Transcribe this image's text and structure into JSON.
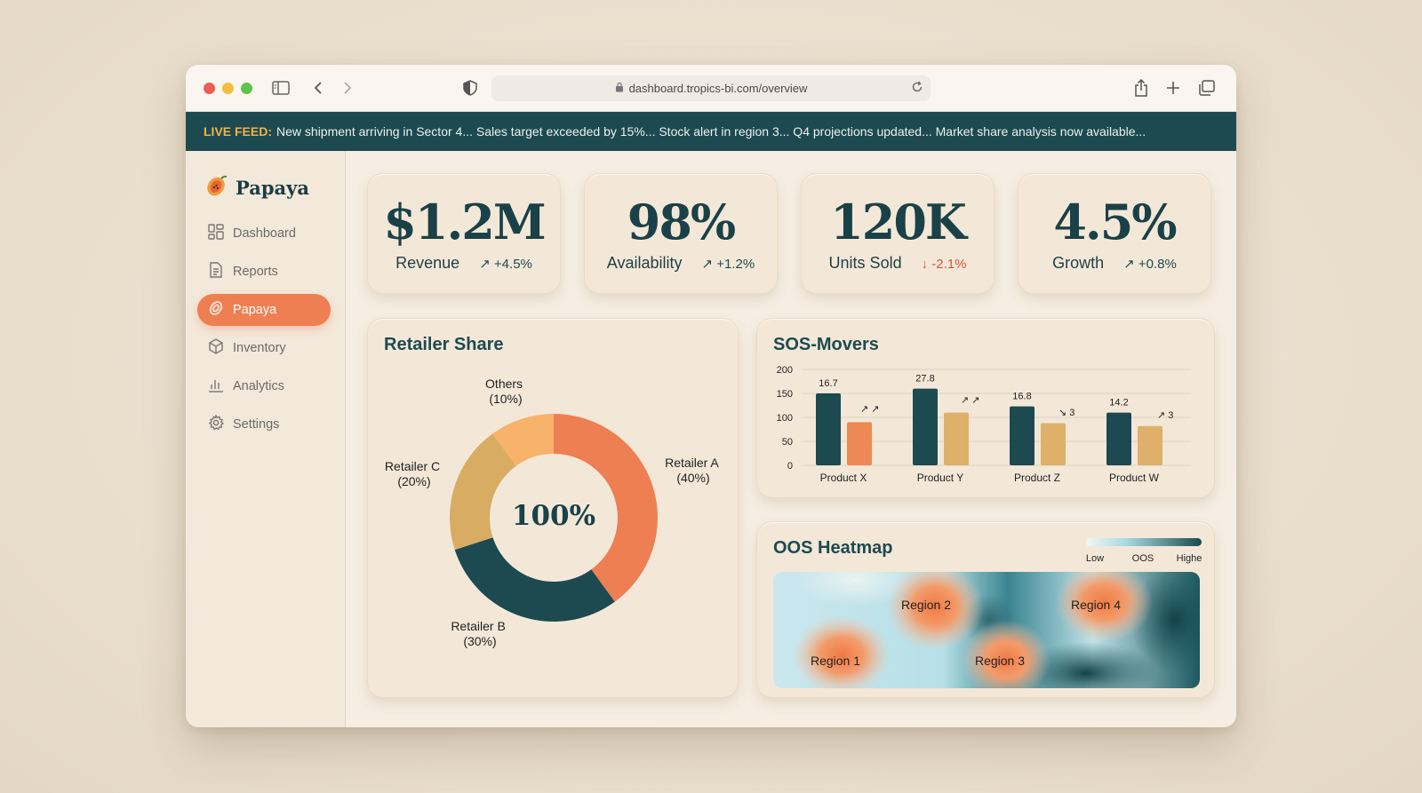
{
  "browser": {
    "url": "dashboard.tropics-bi.com/overview"
  },
  "live_feed": {
    "label": "LIVE FEED:",
    "text": "New shipment arriving in Sector 4... Sales target exceeded by 15%... Stock alert in region 3... Q4 projections updated... Market share analysis now available..."
  },
  "sidebar": {
    "brand": "Papaya",
    "items": [
      {
        "label": "Dashboard",
        "icon": "grid-icon",
        "active": false
      },
      {
        "label": "Reports",
        "icon": "document-icon",
        "active": false
      },
      {
        "label": "Papaya",
        "icon": "papaya-icon",
        "active": true
      },
      {
        "label": "Inventory",
        "icon": "box-icon",
        "active": false
      },
      {
        "label": "Analytics",
        "icon": "bar-chart-icon",
        "active": false
      },
      {
        "label": "Settings",
        "icon": "gear-icon",
        "active": false
      }
    ]
  },
  "kpis": [
    {
      "value": "$1.2M",
      "label": "Revenue",
      "change": "↗ +4.5%",
      "trend": "up"
    },
    {
      "value": "98%",
      "label": "Availability",
      "change": "↗ +1.2%",
      "trend": "up"
    },
    {
      "value": "120K",
      "label": "Units Sold",
      "change": "↓ -2.1%",
      "trend": "down"
    },
    {
      "value": "4.5%",
      "label": "Growth",
      "change": "↗ +0.8%",
      "trend": "up"
    }
  ],
  "colors": {
    "teal": "#1d4a50",
    "orange": "#ee7f52",
    "sand": "#d9ac64",
    "peach": "#f7b36b"
  },
  "retailer_share": {
    "title": "Retailer Share",
    "center_label": "100%",
    "labels": [
      {
        "name": "Retailer A",
        "pct": "(40%)"
      },
      {
        "name": "Retailer B",
        "pct": "(30%)"
      },
      {
        "name": "Retailer C",
        "pct": "(20%)"
      },
      {
        "name": "Others",
        "pct": "(10%)"
      }
    ]
  },
  "sos_movers": {
    "title": "SOS-Movers",
    "annotations": [
      "↗ ↗",
      "↗ ↗",
      "↘ 3",
      "↗ 3"
    ]
  },
  "heatmap": {
    "title": "OOS Heatmap",
    "legend": [
      "Low",
      "OOS",
      "Highe"
    ],
    "regions": [
      "Region 1",
      "Region 2",
      "Region 3",
      "Region 4"
    ]
  },
  "chart_data": [
    {
      "type": "pie",
      "title": "Retailer Share",
      "categories": [
        "Retailer A",
        "Retailer B",
        "Retailer C",
        "Others"
      ],
      "values": [
        40,
        30,
        20,
        10
      ]
    },
    {
      "type": "bar",
      "title": "SOS-Movers",
      "categories": [
        "Product X",
        "Product Y",
        "Product Z",
        "Product W"
      ],
      "ylim": [
        0,
        200
      ],
      "yticks": [
        0,
        50,
        100,
        150,
        200
      ],
      "series": [
        {
          "values": [
            150,
            160,
            123,
            110
          ],
          "labels": [
            "16.7",
            "27.8",
            "16.8",
            "14.2"
          ]
        },
        {
          "values": [
            90,
            110,
            88,
            82
          ]
        }
      ]
    }
  ]
}
